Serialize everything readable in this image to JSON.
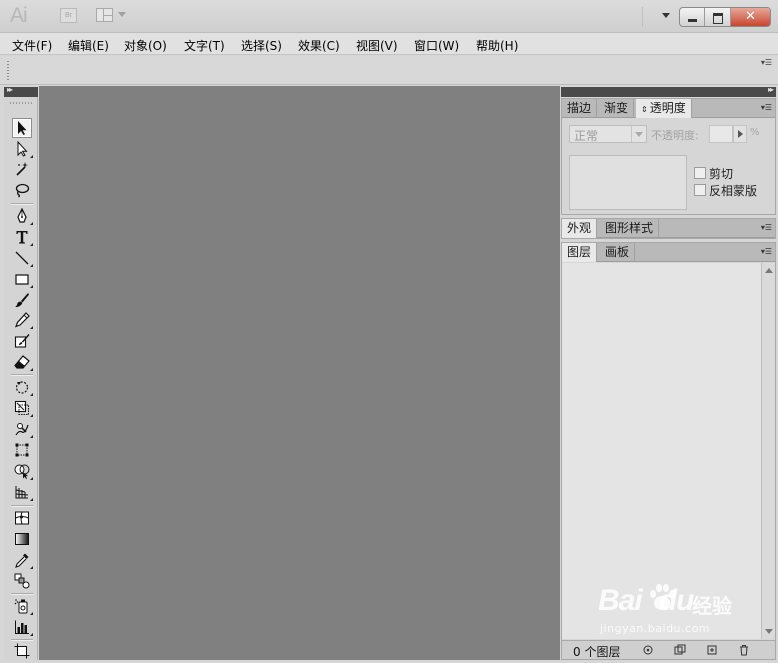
{
  "titlebar": {
    "app_logo": "Ai",
    "bridge_label": "Br"
  },
  "menu": [
    {
      "label": "文件(F)"
    },
    {
      "label": "编辑(E)"
    },
    {
      "label": "对象(O)"
    },
    {
      "label": "文字(T)"
    },
    {
      "label": "选择(S)"
    },
    {
      "label": "效果(C)"
    },
    {
      "label": "视图(V)"
    },
    {
      "label": "窗口(W)"
    },
    {
      "label": "帮助(H)"
    }
  ],
  "tools": [
    {
      "name": "selection-tool",
      "icon": "arrow-black",
      "selected": true
    },
    {
      "name": "direct-selection-tool",
      "icon": "arrow-white"
    },
    {
      "name": "magic-wand-tool",
      "icon": "magic-wand"
    },
    {
      "name": "lasso-tool",
      "icon": "lasso"
    },
    {
      "name": "pen-tool",
      "icon": "pen"
    },
    {
      "name": "type-tool",
      "icon": "type-T"
    },
    {
      "name": "line-segment-tool",
      "icon": "line"
    },
    {
      "name": "rectangle-tool",
      "icon": "rectangle"
    },
    {
      "name": "paintbrush-tool",
      "icon": "brush"
    },
    {
      "name": "pencil-tool",
      "icon": "pencil"
    },
    {
      "name": "blob-brush-tool",
      "icon": "blob-brush"
    },
    {
      "name": "eraser-tool",
      "icon": "eraser"
    },
    {
      "name": "rotate-tool",
      "icon": "rotate"
    },
    {
      "name": "scale-tool",
      "icon": "scale"
    },
    {
      "name": "warp-tool",
      "icon": "warp"
    },
    {
      "name": "free-transform-tool",
      "icon": "free-transform"
    },
    {
      "name": "shape-builder-tool",
      "icon": "shape-builder"
    },
    {
      "name": "perspective-grid-tool",
      "icon": "perspective-grid"
    },
    {
      "name": "mesh-tool",
      "icon": "mesh"
    },
    {
      "name": "gradient-tool",
      "icon": "gradient"
    },
    {
      "name": "eyedropper-tool",
      "icon": "eyedropper"
    },
    {
      "name": "blend-tool",
      "icon": "blend"
    },
    {
      "name": "symbol-sprayer-tool",
      "icon": "symbol-sprayer"
    },
    {
      "name": "column-graph-tool",
      "icon": "column-graph"
    },
    {
      "name": "artboard-tool",
      "icon": "artboard"
    }
  ],
  "panels": {
    "stroke_group": {
      "tabs": [
        "描边",
        "渐变",
        "透明度"
      ],
      "active_tab": "透明度",
      "transparency": {
        "blend_mode": "正常",
        "opacity_label": "不透明度:",
        "opacity_value": "",
        "opacity_unit": "%",
        "clip_label": "剪切",
        "invert_mask_label": "反相蒙版"
      }
    },
    "appearance_group": {
      "tabs": [
        "外观",
        "图形样式"
      ],
      "active_tab": "外观"
    },
    "layers_group": {
      "tabs": [
        "图层",
        "画板"
      ],
      "active_tab": "图层",
      "footer_count": "0 个图层"
    }
  },
  "watermark": {
    "brand": "Bai",
    "brand2": "du",
    "cn": "经验",
    "url": "jingyan.baidu.com"
  },
  "colors": {
    "canvas": "#808080",
    "chrome": "#d6d6d6",
    "panel_header": "#4a4a4a",
    "close_button": "#c8452f"
  }
}
